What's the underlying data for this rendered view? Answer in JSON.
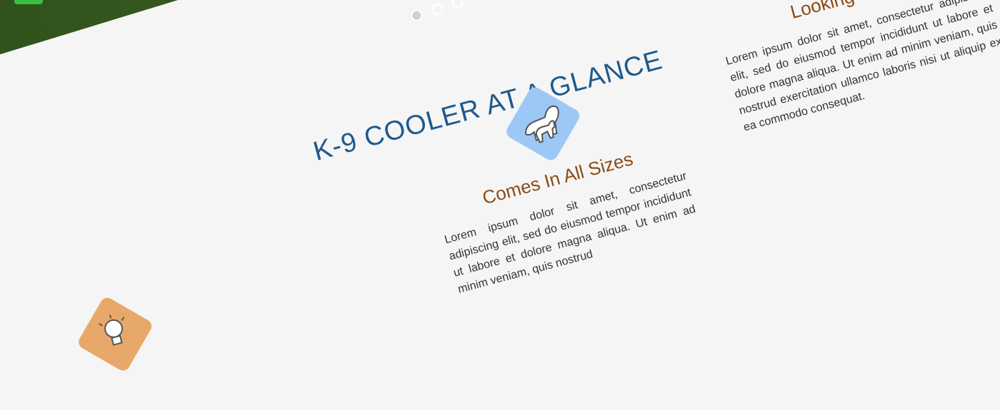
{
  "hero": {
    "slider_dots": [
      "slide-1",
      "slide-2",
      "slide-3"
    ],
    "active_dot": 0
  },
  "section": {
    "title": "K-9 COOLER AT A GLANCE"
  },
  "features": [
    {
      "icon": "lightbulb-icon",
      "title": "",
      "body": ""
    },
    {
      "icon": "dogs-icon",
      "title": "Comes In All Sizes",
      "body": "Lorem ipsum dolor sit amet, consectetur adipiscing elit, sed do eiusmod tempor incididunt ut labore et dolore magna aliqua. Ut enim ad minim veniam, quis nostrud"
    },
    {
      "icon": "bow-icon",
      "title": "Looking Good!",
      "body": "Lorem ipsum dolor sit amet, consectetur adipiscing elit, sed do eiusmod tempor incididunt ut labore et dolore magna aliqua. Ut enim ad minim veniam, quis nostrud exercitation ullamco laboris nisi ut aliquip ex ea commodo consequat."
    }
  ],
  "colors": {
    "title_blue": "#1e5a8e",
    "feature_title_brown": "#8a4b14",
    "hero_green": "#3d6526",
    "accent_green": "#3bbf3e",
    "icon_orange": "#e8a86a",
    "icon_blue": "#9cc8f5"
  }
}
